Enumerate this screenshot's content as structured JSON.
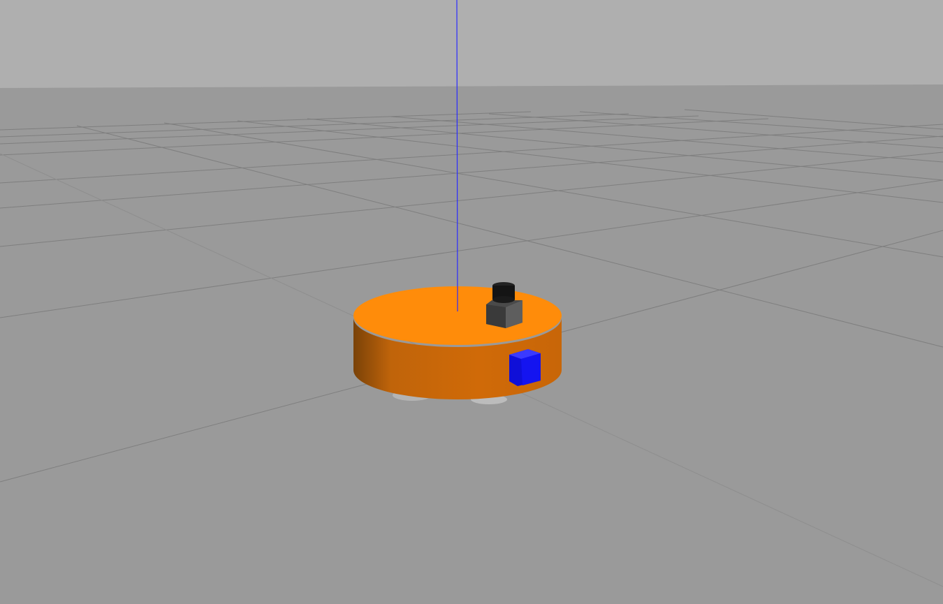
{
  "scene": {
    "sky_color": "#afafaf",
    "ground_color": "#9a9a9a",
    "grid_color": "#7a7a7a",
    "grid_faint_color": "#8e8e8e",
    "z_axis_color": "#2a2aff",
    "robot": {
      "base_color": "#ff8c0a",
      "base_side_color": "#d06a08",
      "base_shadow_color": "#8a4a08",
      "lidar_color": "#1a1a1a",
      "lidar_mount_color": "#5a5a5a",
      "camera_color": "#1010ee",
      "wheel_color": "#b8b8b8"
    }
  }
}
